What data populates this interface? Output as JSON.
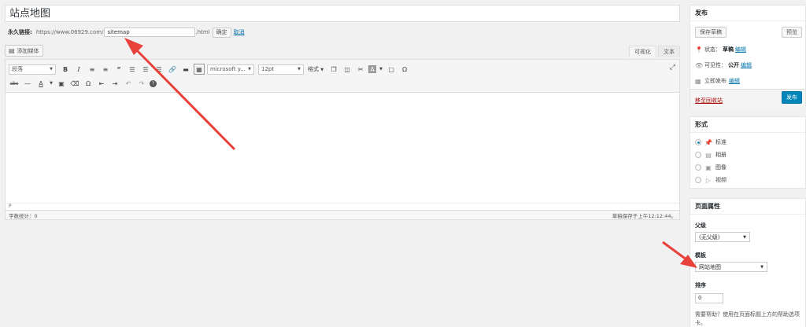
{
  "editor": {
    "title": "站点地图",
    "permalink": {
      "label": "永久链接:",
      "base_url": "https://www.06929.com/",
      "slug": "sitemap",
      "suffix": ".html",
      "ok_label": "确定",
      "cancel_label": "取消"
    },
    "add_media_label": "添加媒体",
    "tabs": [
      "可视化",
      "文本"
    ],
    "toolbar": {
      "paragraph_select": "段落",
      "font_select": "microsoft y...",
      "size_select": "12pt",
      "format_label": "格式"
    },
    "path": "P",
    "word_count": "字数统计：0",
    "draft_saved": "草稿保存于上午12:12:44。"
  },
  "publish_box": {
    "title": "发布",
    "save_draft": "保存草稿",
    "preview": "预览",
    "status_label": "状态：",
    "status_value": "草稿",
    "visibility_label": "可见性：",
    "visibility_value": "公开",
    "schedule_label": "立即发布",
    "edit_label": "编辑",
    "trash_label": "移至回收站",
    "publish_button": "发布"
  },
  "format_box": {
    "title": "形式",
    "options": [
      {
        "label": "标准",
        "icon": "pin-icon"
      },
      {
        "label": "相册",
        "icon": "gallery-icon"
      },
      {
        "label": "图像",
        "icon": "image-icon"
      },
      {
        "label": "视频",
        "icon": "video-icon"
      }
    ],
    "selected": 0
  },
  "page_attributes": {
    "title": "页面属性",
    "parent_label": "父级",
    "parent_value": "(无父级)",
    "template_label": "模板",
    "template_value": "网站地图",
    "order_label": "排序",
    "order_value": "0",
    "help_text": "需要帮助？使用在页面标题上方的帮助选项卡。"
  },
  "colors": {
    "accent": "#0085ba",
    "link": "#0073aa",
    "danger": "#aa0000",
    "arrow": "#e8403a"
  }
}
